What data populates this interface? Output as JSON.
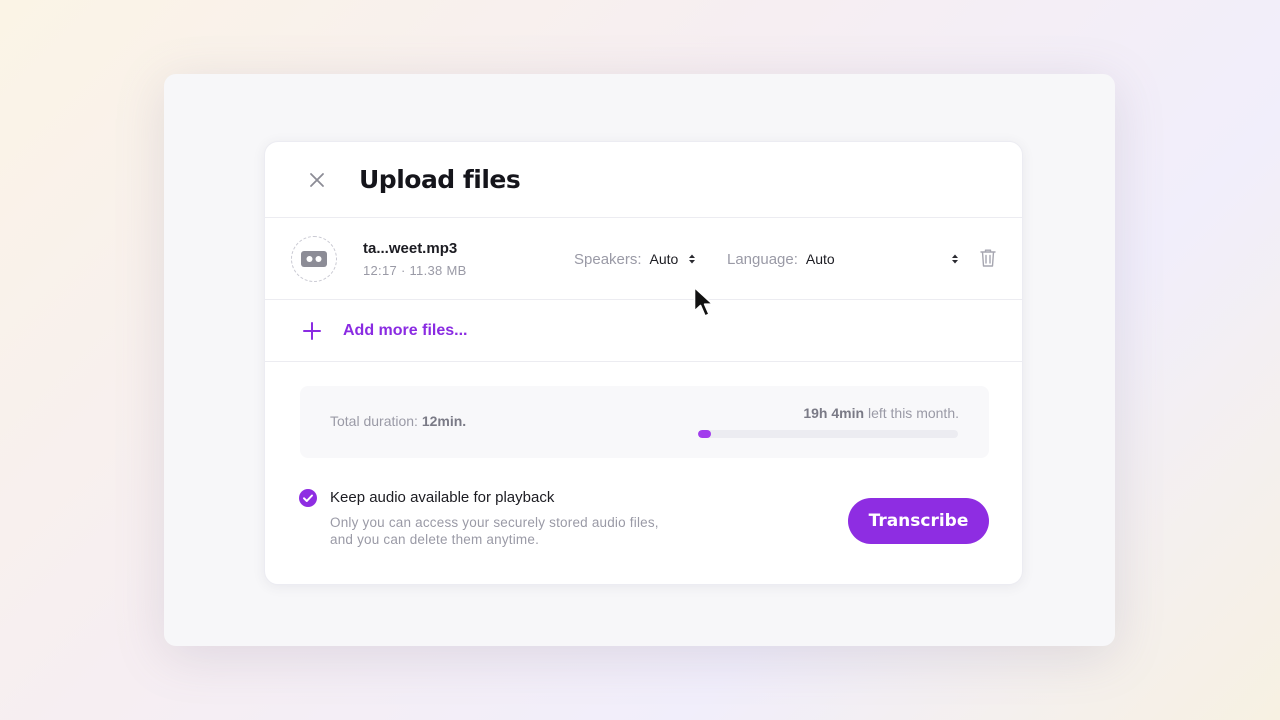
{
  "modal": {
    "title": "Upload files"
  },
  "file": {
    "name": "ta...weet.mp3",
    "meta": "12:17 · 11.38 MB",
    "speakers_label": "Speakers:",
    "speakers_value": "Auto",
    "language_label": "Language:",
    "language_value": "Auto"
  },
  "add_files": {
    "label": "Add more files..."
  },
  "usage": {
    "total_prefix": "Total duration: ",
    "total_value": "12min.",
    "left_value": "19h 4min",
    "left_suffix": " left this month.",
    "progress_fraction": 0.05
  },
  "playback": {
    "checked": true,
    "title": "Keep audio available for playback",
    "description": "Only you can access your securely stored audio files, and you can delete them anytime."
  },
  "actions": {
    "transcribe_label": "Transcribe"
  },
  "colors": {
    "accent": "#8e2de2",
    "progress": "#a23ded"
  },
  "icons": {
    "close": "close-icon",
    "file": "cassette-icon",
    "trash": "trash-icon",
    "plus": "plus-icon",
    "check": "check-circle-icon",
    "cursor": "mouse-pointer-icon"
  }
}
